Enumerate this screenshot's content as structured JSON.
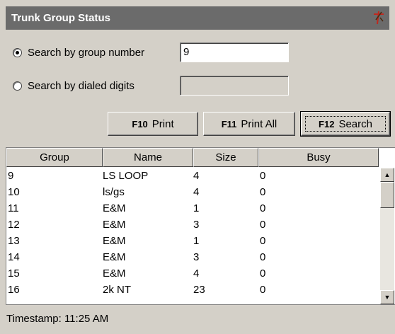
{
  "title": "Trunk Group Status",
  "title_icon": "pin-icon",
  "search": {
    "by_group_label": "Search by group number",
    "by_group_value": "9",
    "by_group_checked": true,
    "by_digits_label": "Search by dialed digits",
    "by_digits_value": ""
  },
  "buttons": {
    "print_key": "F10",
    "print_label": "Print",
    "print_all_key": "F11",
    "print_all_label": "Print All",
    "search_key": "F12",
    "search_label": "Search"
  },
  "table": {
    "columns": [
      "Group",
      "Name",
      "Size",
      "Busy"
    ],
    "rows": [
      [
        "9",
        "LS LOOP",
        "4",
        "0"
      ],
      [
        "10",
        "ls/gs",
        "4",
        "0"
      ],
      [
        "11",
        "E&M",
        "1",
        "0"
      ],
      [
        "12",
        "E&M",
        "3",
        "0"
      ],
      [
        "13",
        "E&M",
        "1",
        "0"
      ],
      [
        "14",
        "E&M",
        "3",
        "0"
      ],
      [
        "15",
        "E&M",
        "4",
        "0"
      ],
      [
        "16",
        "2k NT",
        "23",
        "0"
      ]
    ]
  },
  "status": {
    "timestamp": "Timestamp: 11:25 AM"
  },
  "colors": {
    "titlebar": "#6b6b6b",
    "panel": "#d4d0c8",
    "pin_red": "#c0281e"
  }
}
